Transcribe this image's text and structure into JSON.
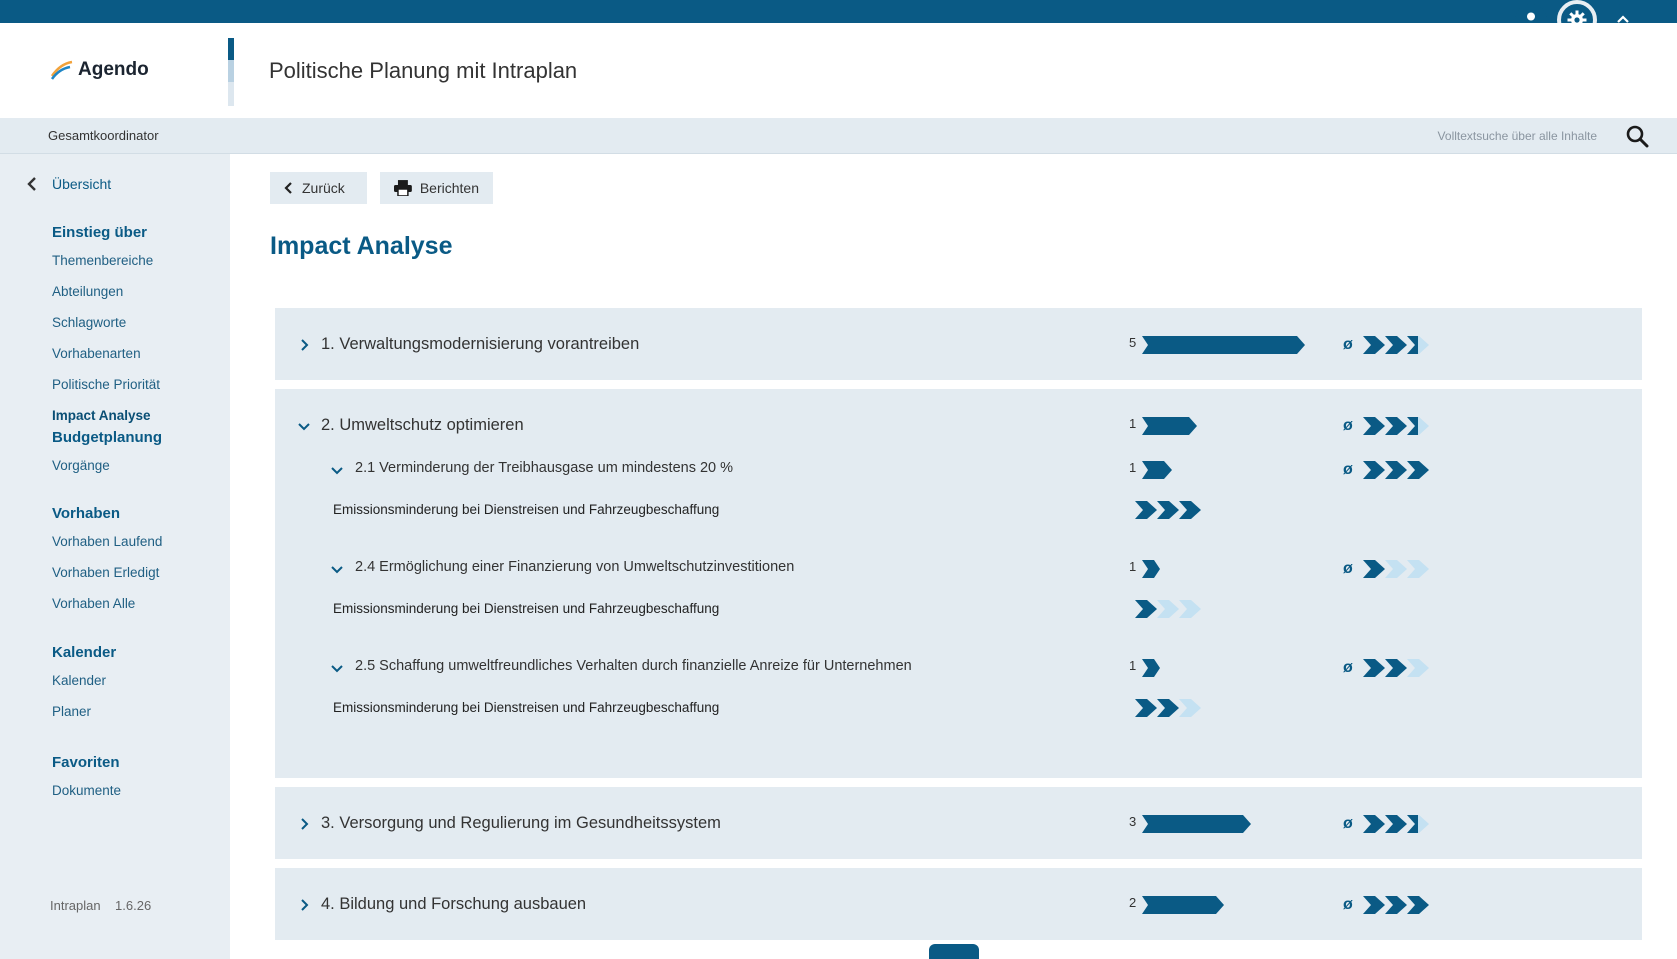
{
  "header": {
    "logo_text": "Agendo",
    "title": "Politische Planung mit Intraplan",
    "role": "Gesamtkoordinator",
    "search_placeholder": "Volltextsuche über alle Inhalte"
  },
  "topbar": {
    "icons": [
      "user-icon",
      "gear-icon",
      "chevron-up-icon"
    ]
  },
  "sidebar": {
    "back_label": "Übersicht",
    "groups": [
      {
        "heading": "Einstieg über",
        "items": [
          "Themenbereiche",
          "Abteilungen",
          "Schlagworte",
          "Vorhabenarten",
          "Politische Priorität",
          "Impact Analyse"
        ]
      },
      {
        "heading": "Budgetplanung",
        "items": [
          "Vorgänge"
        ]
      },
      {
        "heading": "Vorhaben",
        "items": [
          "Vorhaben Laufend",
          "Vorhaben Erledigt",
          "Vorhaben Alle"
        ]
      },
      {
        "heading": "Kalender",
        "items": [
          "Kalender",
          "Planer"
        ]
      },
      {
        "heading": "Favoriten",
        "items": [
          "Dokumente"
        ]
      }
    ],
    "active_item": "Impact Analyse",
    "version": "Intraplan    1.6.26"
  },
  "toolbar": {
    "back_label": "Zurück",
    "report_label": "Berichten"
  },
  "page": {
    "title": "Impact Analyse",
    "avg_symbol": "ø",
    "goals": [
      {
        "label": "1. Verwaltungsmodernisierung vorantreiben",
        "count": "5",
        "avg_level": 2.5,
        "expanded": false
      },
      {
        "label": "2. Umweltschutz optimieren",
        "count": "1",
        "avg_level": 2.5,
        "expanded": true,
        "subgoals": [
          {
            "label": "2.1 Verminderung der Treibhausgase um mindestens 20 %",
            "count": "1",
            "avg_level": 3,
            "measure": {
              "label": "Emissionsminderung bei Dienstreisen und Fahrzeugbeschaffung",
              "level": 3
            }
          },
          {
            "label": "2.4 Ermöglichung einer Finanzierung von Umweltschutzinvestitionen",
            "count": "1",
            "avg_level": 1,
            "measure": {
              "label": "Emissionsminderung bei Dienstreisen und Fahrzeugbeschaffung",
              "level": 1
            }
          },
          {
            "label": "2.5 Schaffung umweltfreundliches Verhalten durch finanzielle Anreize für Unternehmen",
            "count": "1",
            "avg_level": 2,
            "measure": {
              "label": "Emissionsminderung bei Dienstreisen und Fahrzeugbeschaffung",
              "level": 2
            }
          }
        ]
      },
      {
        "label": "3. Versorgung und Regulierung im Gesundheitssystem",
        "count": "3",
        "avg_level": 2.5,
        "expanded": false
      },
      {
        "label": "4. Bildung und Forschung ausbauen",
        "count": "2",
        "avg_level": 3,
        "expanded": false
      }
    ]
  },
  "colors": {
    "brand": "#0a5a85",
    "light_chevron": "#c4e1f2",
    "panel_bg": "#e3ebf1"
  }
}
